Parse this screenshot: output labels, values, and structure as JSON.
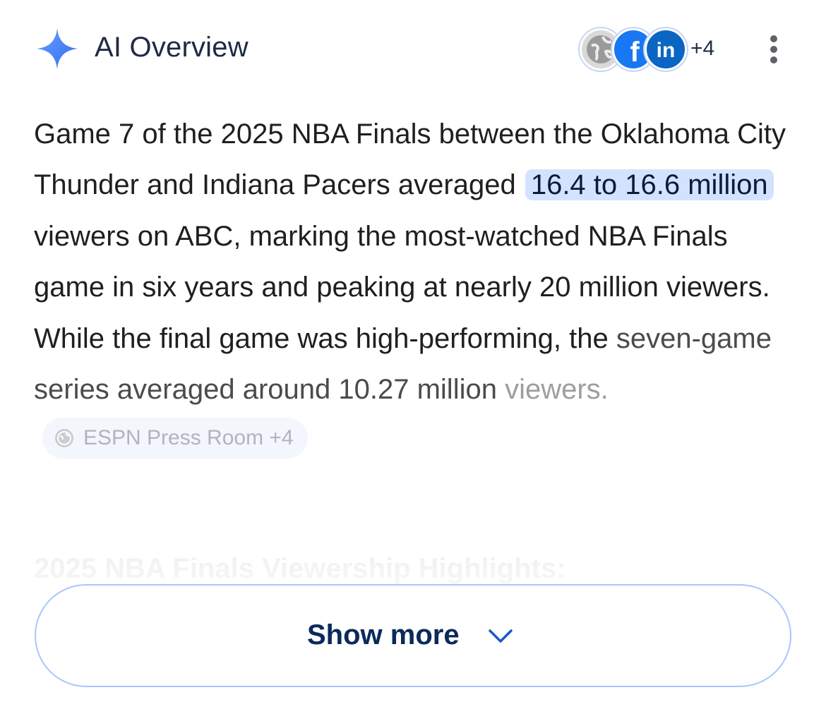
{
  "header": {
    "title": "AI Overview",
    "sources_more": "+4",
    "icon": "sparkle-icon",
    "accent_color": "#4285f4"
  },
  "sources": [
    {
      "icon": "globe-icon",
      "label": ""
    },
    {
      "icon": "facebook-icon",
      "label": "f"
    },
    {
      "icon": "linkedin-icon",
      "label": "in"
    }
  ],
  "body": {
    "t1": "Game 7 of the 2025 NBA Finals between the Oklahoma City Thunder and Indiana Pacers averaged",
    "highlight": "16.4 to 16.6 million",
    "t2": "viewers on ABC, marking the most-watched NBA Finals game in six years and peaking at nearly 20 million viewers. While the final game was high-performing, the",
    "t3": "seven-game series averaged around 10.27 million",
    "t4": "viewers.",
    "citation": "ESPN Press Room +4",
    "highlight_color": "#d3e3fd"
  },
  "faded_heading": "2025 NBA Finals Viewership Highlights:",
  "show_more": {
    "label": "Show more",
    "icon": "chevron-down-icon",
    "border_color": "#a8c7fa"
  }
}
